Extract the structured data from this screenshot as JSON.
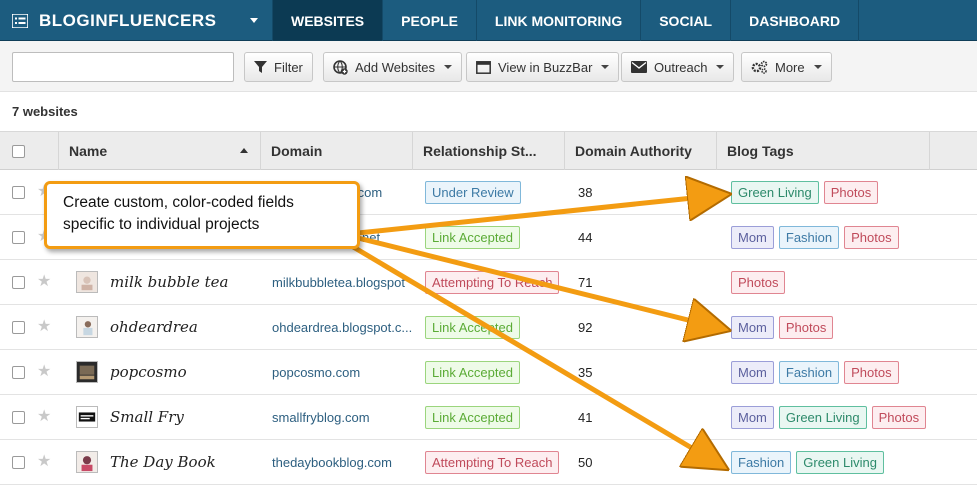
{
  "header": {
    "brand": "BLOGINFLUENCERS",
    "tabs": [
      {
        "label": "WEBSITES",
        "active": true
      },
      {
        "label": "PEOPLE",
        "active": false
      },
      {
        "label": "LINK MONITORING",
        "active": false
      },
      {
        "label": "SOCIAL",
        "active": false
      },
      {
        "label": "DASHBOARD",
        "active": false
      }
    ]
  },
  "toolbar": {
    "search_value": "",
    "filter_label": "Filter",
    "add_websites_label": "Add Websites",
    "view_buzzbar_label": "View in BuzzBar",
    "outreach_label": "Outreach",
    "more_label": "More"
  },
  "list": {
    "count_label": "7 websites",
    "columns": {
      "name": "Name",
      "domain": "Domain",
      "relationship": "Relationship St...",
      "authority": "Domain Authority",
      "tags": "Blog Tags"
    },
    "rows": [
      {
        "name": "",
        "domain": ".com",
        "relationship": "Under Review",
        "rel_status": "review",
        "authority": "38",
        "tags": [
          "Green Living",
          "Photos"
        ]
      },
      {
        "name": "",
        "domain": "net",
        "relationship": "Link Accepted",
        "rel_status": "accepted",
        "authority": "44",
        "tags": [
          "Mom",
          "Fashion",
          "Photos"
        ]
      },
      {
        "name": "milk bubble tea",
        "domain": "milkbubbletea.blogspot",
        "relationship": "Attempting To Reach",
        "rel_status": "attempt",
        "authority": "71",
        "tags": [
          "Photos"
        ]
      },
      {
        "name": "ohdeardrea",
        "domain": "ohdeardrea.blogspot.c...",
        "relationship": "Link Accepted",
        "rel_status": "accepted",
        "authority": "92",
        "tags": [
          "Mom",
          "Photos"
        ]
      },
      {
        "name": "popcosmo",
        "domain": "popcosmo.com",
        "relationship": "Link Accepted",
        "rel_status": "accepted",
        "authority": "35",
        "tags": [
          "Mom",
          "Fashion",
          "Photos"
        ]
      },
      {
        "name": "Small Fry",
        "domain": "smallfryblog.com",
        "relationship": "Link Accepted",
        "rel_status": "accepted",
        "authority": "41",
        "tags": [
          "Mom",
          "Green Living",
          "Photos"
        ]
      },
      {
        "name": "The Day Book",
        "domain": "thedaybookblog.com",
        "relationship": "Attempting To Reach",
        "rel_status": "attempt",
        "authority": "50",
        "tags": [
          "Fashion",
          "Green Living"
        ]
      }
    ]
  },
  "callout": {
    "line1": "Create custom, color-coded fields",
    "line2": "specific to individual projects"
  },
  "colors": {
    "nav_bg": "#1c5c7f",
    "nav_active": "#0c3a53",
    "callout_border": "#f39c12",
    "arrow": "#f39c12"
  }
}
